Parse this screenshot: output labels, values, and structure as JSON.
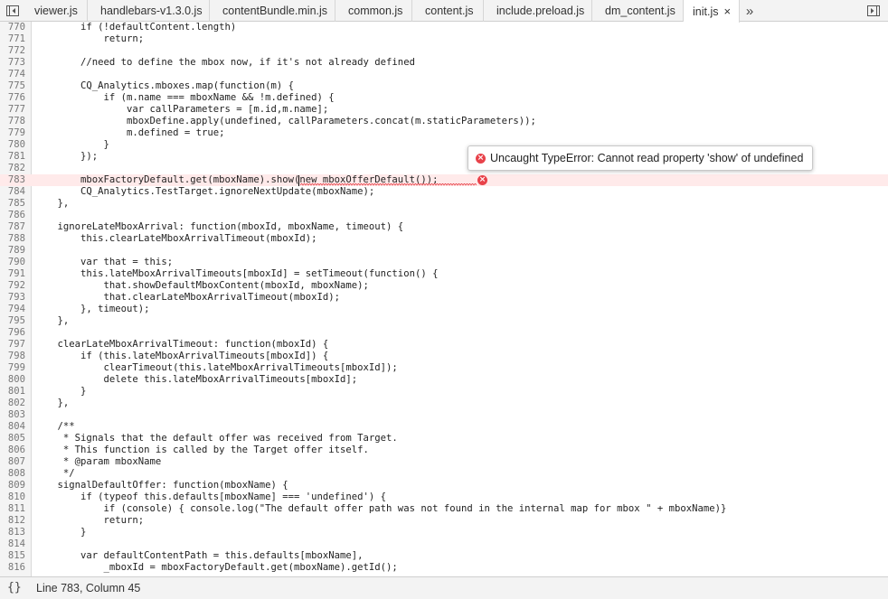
{
  "tabs": [
    {
      "label": "viewer.js"
    },
    {
      "label": "handlebars-v1.3.0.js"
    },
    {
      "label": "contentBundle.min.js"
    },
    {
      "label": "common.js"
    },
    {
      "label": "content.js"
    },
    {
      "label": "include.preload.js"
    },
    {
      "label": "dm_content.js"
    },
    {
      "label": "init.js",
      "active": true
    }
  ],
  "tab_close_glyph": "×",
  "more_tabs_glyph": "»",
  "error": {
    "line": 783,
    "message": "Uncaught TypeError: Cannot read property 'show' of undefined",
    "icon_glyph": "×"
  },
  "code_lines": [
    {
      "n": "770",
      "t": "        if (!defaultContent.length)"
    },
    {
      "n": "771",
      "t": "            return;"
    },
    {
      "n": "772",
      "t": ""
    },
    {
      "n": "773",
      "t": "        //need to define the mbox now, if it's not already defined"
    },
    {
      "n": "774",
      "t": ""
    },
    {
      "n": "775",
      "t": "        CQ_Analytics.mboxes.map(function(m) {"
    },
    {
      "n": "776",
      "t": "            if (m.name === mboxName && !m.defined) {"
    },
    {
      "n": "777",
      "t": "                var callParameters = [m.id,m.name];"
    },
    {
      "n": "778",
      "t": "                mboxDefine.apply(undefined, callParameters.concat(m.staticParameters));"
    },
    {
      "n": "779",
      "t": "                m.defined = true;"
    },
    {
      "n": "780",
      "t": "            }"
    },
    {
      "n": "781",
      "t": "        });"
    },
    {
      "n": "782",
      "t": ""
    },
    {
      "n": "783",
      "t": "        mboxFactoryDefault.get(mboxName).show(new mboxOfferDefault());"
    },
    {
      "n": "784",
      "t": "        CQ_Analytics.TestTarget.ignoreNextUpdate(mboxName);"
    },
    {
      "n": "785",
      "t": "    },"
    },
    {
      "n": "786",
      "t": ""
    },
    {
      "n": "787",
      "t": "    ignoreLateMboxArrival: function(mboxId, mboxName, timeout) {"
    },
    {
      "n": "788",
      "t": "        this.clearLateMboxArrivalTimeout(mboxId);"
    },
    {
      "n": "789",
      "t": ""
    },
    {
      "n": "790",
      "t": "        var that = this;"
    },
    {
      "n": "791",
      "t": "        this.lateMboxArrivalTimeouts[mboxId] = setTimeout(function() {"
    },
    {
      "n": "792",
      "t": "            that.showDefaultMboxContent(mboxId, mboxName);"
    },
    {
      "n": "793",
      "t": "            that.clearLateMboxArrivalTimeout(mboxId);"
    },
    {
      "n": "794",
      "t": "        }, timeout);"
    },
    {
      "n": "795",
      "t": "    },"
    },
    {
      "n": "796",
      "t": ""
    },
    {
      "n": "797",
      "t": "    clearLateMboxArrivalTimeout: function(mboxId) {"
    },
    {
      "n": "798",
      "t": "        if (this.lateMboxArrivalTimeouts[mboxId]) {"
    },
    {
      "n": "799",
      "t": "            clearTimeout(this.lateMboxArrivalTimeouts[mboxId]);"
    },
    {
      "n": "800",
      "t": "            delete this.lateMboxArrivalTimeouts[mboxId];"
    },
    {
      "n": "801",
      "t": "        }"
    },
    {
      "n": "802",
      "t": "    },"
    },
    {
      "n": "803",
      "t": ""
    },
    {
      "n": "804",
      "t": "    /**"
    },
    {
      "n": "805",
      "t": "     * Signals that the default offer was received from Target."
    },
    {
      "n": "806",
      "t": "     * This function is called by the Target offer itself."
    },
    {
      "n": "807",
      "t": "     * @param mboxName"
    },
    {
      "n": "808",
      "t": "     */"
    },
    {
      "n": "809",
      "t": "    signalDefaultOffer: function(mboxName) {"
    },
    {
      "n": "810",
      "t": "        if (typeof this.defaults[mboxName] === 'undefined') {"
    },
    {
      "n": "811",
      "t": "            if (console) { console.log(\"The default offer path was not found in the internal map for mbox \" + mboxName)}"
    },
    {
      "n": "812",
      "t": "            return;"
    },
    {
      "n": "813",
      "t": "        }"
    },
    {
      "n": "814",
      "t": ""
    },
    {
      "n": "815",
      "t": "        var defaultContentPath = this.defaults[mboxName],"
    },
    {
      "n": "816",
      "t": "            _mboxId = mboxFactoryDefault.get(mboxName).getId();"
    }
  ],
  "status": {
    "braces": "{}",
    "position": "Line 783, Column 45"
  },
  "colors": {
    "error_red": "#e8424a",
    "error_line_bg": "#ffeaea"
  }
}
